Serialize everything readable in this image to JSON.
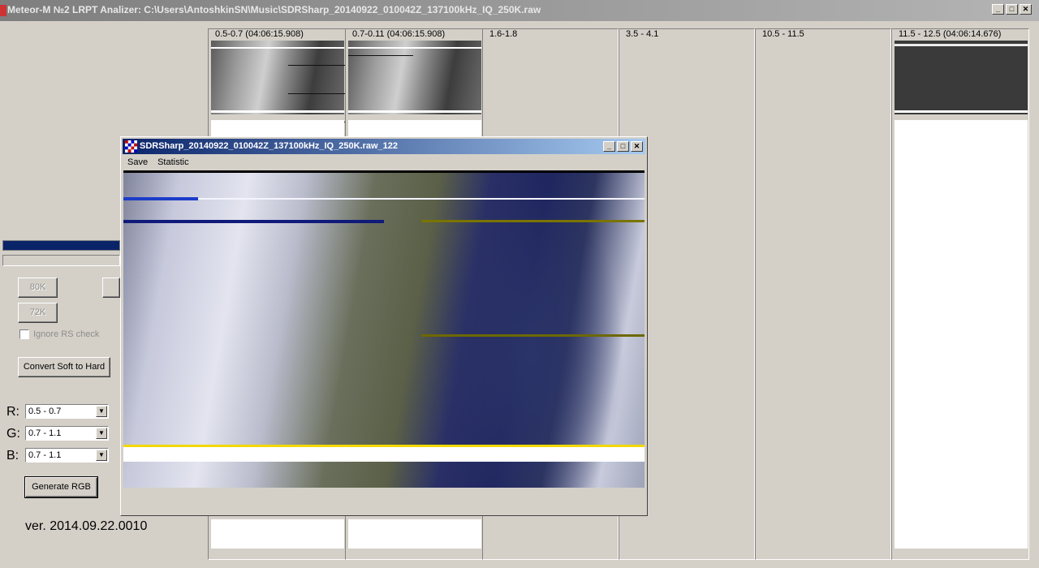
{
  "window": {
    "title": "Meteor-M №2 LRPT Analizer: C:\\Users\\AntoshkinSN\\Music\\SDRSharp_20140922_010042Z_137100kHz_IQ_250K.raw"
  },
  "window_buttons": {
    "minimize": "_",
    "maximize": "□",
    "close": "✕"
  },
  "channels": [
    {
      "label": "0.5-0.7 (04:06:15.908)",
      "image": "visible"
    },
    {
      "label": "0.7-0.11 (04:06:15.908)",
      "image": "visible"
    },
    {
      "label": "1.6-1.8",
      "image": "none"
    },
    {
      "label": "3.5 - 4.1",
      "image": "none"
    },
    {
      "label": "10.5 - 11.5",
      "image": "none"
    },
    {
      "label": "11.5 - 12.5 (04:06:14.676)",
      "image": "visible"
    }
  ],
  "controls": {
    "btn_80k": "80K",
    "btn_72k": "72K",
    "ignore_rs_check": "Ignore RS check",
    "convert_soft_to_hard": "Convert Soft to Hard",
    "r_label": "R:",
    "g_label": "G:",
    "b_label": "B:",
    "r_value": "0.5 - 0.7",
    "g_value": "0.7 - 1.1",
    "b_value": "0.7 - 1.1",
    "generate_rgb": "Generate RGB",
    "version": "ver. 2014.09.22.0010"
  },
  "child_window": {
    "title": "SDRSharp_20140922_010042Z_137100kHz_IQ_250K.raw_122",
    "menu": [
      "Save",
      "Statistic"
    ]
  },
  "colors": {
    "active_title": "#0a246a",
    "progress": "#0a246a",
    "face": "#d4d0c8"
  }
}
